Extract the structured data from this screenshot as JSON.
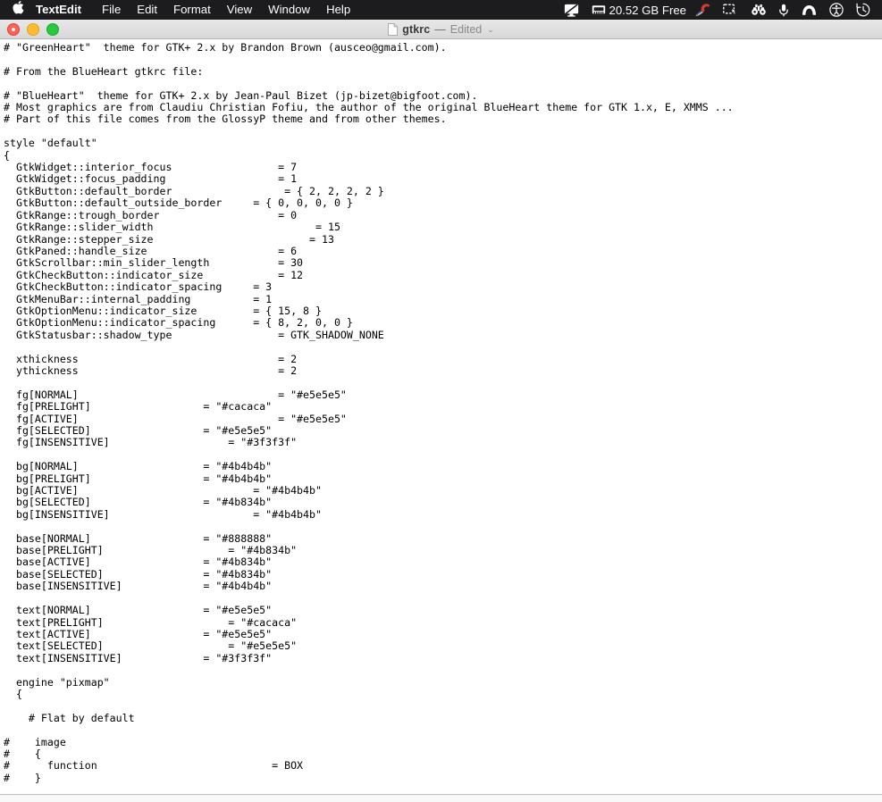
{
  "menubar": {
    "apple_logo": "",
    "items": [
      {
        "label": "TextEdit",
        "name": "menu-textedit",
        "bold": true
      },
      {
        "label": "File",
        "name": "menu-file",
        "bold": false
      },
      {
        "label": "Edit",
        "name": "menu-edit",
        "bold": false
      },
      {
        "label": "Format",
        "name": "menu-format",
        "bold": false
      },
      {
        "label": "View",
        "name": "menu-view",
        "bold": false
      },
      {
        "label": "Window",
        "name": "menu-window",
        "bold": false
      },
      {
        "label": "Help",
        "name": "menu-help",
        "bold": false
      }
    ],
    "status": {
      "display_icon": "display-icon",
      "memory_icon": "memory-chip-icon",
      "disk_free_text": "20.52 GB Free",
      "cleaner_icon": "ccleaner-icon",
      "screenshot_icon": "screenshot-tool-icon",
      "binoculars_icon": "binoculars-icon",
      "microphone_icon": "microphone-icon",
      "malwarebytes_icon": "malwarebytes-icon",
      "accessibility_icon": "accessibility-icon",
      "timemachine_icon": "time-machine-icon"
    },
    "background_color": "#1c1c1e",
    "text_color": "#ffffff"
  },
  "window": {
    "traffic_lights": {
      "close": "close-button",
      "minimize": "minimize-button",
      "maximize": "maximize-button",
      "close_color": "#ff5f57",
      "minimize_color": "#ffbd2e",
      "maximize_color": "#28c840"
    },
    "title": "gtkrc",
    "title_separator": "—",
    "title_state": "Edited",
    "title_chevron": "⌄"
  },
  "document": {
    "filename": "gtkrc",
    "content": "# \"GreenHeart\"  theme for GTK+ 2.x by Brandon Brown (ausceo@gmail.com).\n\n# From the BlueHeart gtkrc file:\n\n# \"BlueHeart\"  theme for GTK+ 2.x by Jean-Paul Bizet (jp-bizet@bigfoot.com).\n# Most graphics are from Claudiu Christian Fofiu, the author of the original BlueHeart theme for GTK 1.x, E, XMMS ...\n# Part of this file comes from the GlossyP theme and from other themes.\n\nstyle \"default\"\n{\n  GtkWidget::interior_focus                 = 7\n  GtkWidget::focus_padding                  = 1\n  GtkButton::default_border                  = { 2, 2, 2, 2 }\n  GtkButton::default_outside_border     = { 0, 0, 0, 0 }\n  GtkRange::trough_border                   = 0\n  GtkRange::slider_width                          = 15\n  GtkRange::stepper_size                         = 13\n  GtkPaned::handle_size                     = 6\n  GtkScrollbar::min_slider_length           = 30\n  GtkCheckButton::indicator_size            = 12\n  GtkCheckButton::indicator_spacing     = 3\n  GtkMenuBar::internal_padding          = 1\n  GtkOptionMenu::indicator_size         = { 15, 8 }\n  GtkOptionMenu::indicator_spacing      = { 8, 2, 0, 0 }\n  GtkStatusbar::shadow_type                 = GTK_SHADOW_NONE\n\n  xthickness                                = 2\n  ythickness                                = 2\n\n  fg[NORMAL]                                = \"#e5e5e5\"\n  fg[PRELIGHT]                  = \"#cacaca\"\n  fg[ACTIVE]                                = \"#e5e5e5\"\n  fg[SELECTED]                  = \"#e5e5e5\"\n  fg[INSENSITIVE]                   = \"#3f3f3f\"\n\n  bg[NORMAL]                    = \"#4b4b4b\"\n  bg[PRELIGHT]                  = \"#4b4b4b\"\n  bg[ACTIVE]                            = \"#4b4b4b\"\n  bg[SELECTED]                  = \"#4b834b\"\n  bg[INSENSITIVE]                       = \"#4b4b4b\"\n\n  base[NORMAL]                  = \"#888888\"\n  base[PRELIGHT]                    = \"#4b834b\"\n  base[ACTIVE]                  = \"#4b834b\"\n  base[SELECTED]                = \"#4b834b\"\n  base[INSENSITIVE]             = \"#4b4b4b\"\n\n  text[NORMAL]                  = \"#e5e5e5\"\n  text[PRELIGHT]                    = \"#cacaca\"\n  text[ACTIVE]                  = \"#e5e5e5\"\n  text[SELECTED]                    = \"#e5e5e5\"\n  text[INSENSITIVE]             = \"#3f3f3f\"\n\n  engine \"pixmap\"\n  {\n\n    # Flat by default\n\n#    image\n#    {\n#      function                            = BOX\n#    }\n\n    # handle"
  }
}
